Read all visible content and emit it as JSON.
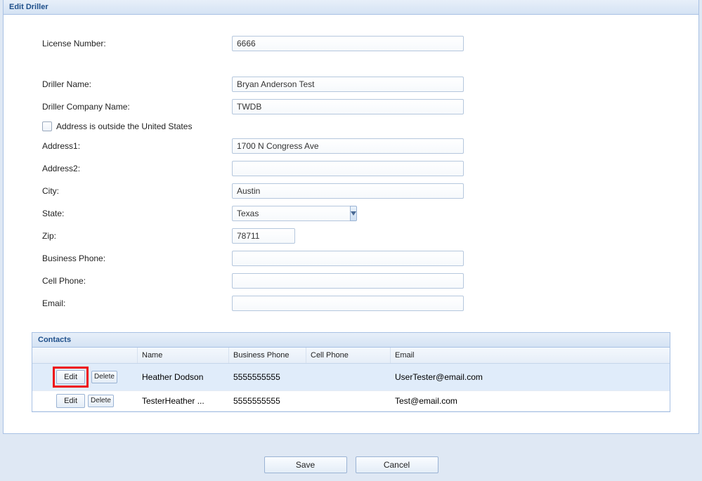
{
  "panel_title": "Edit Driller",
  "form": {
    "license_label": "License Number:",
    "license_value": "6666",
    "driller_name_label": "Driller Name:",
    "driller_name_value": "Bryan Anderson Test",
    "company_label": "Driller Company Name:",
    "company_value": "TWDB",
    "foreign_address_label": "Address is outside the United States",
    "address1_label": "Address1:",
    "address1_value": "1700 N Congress Ave",
    "address2_label": "Address2:",
    "address2_value": "",
    "city_label": "City:",
    "city_value": "Austin",
    "state_label": "State:",
    "state_value": "Texas",
    "zip_label": "Zip:",
    "zip_value": "78711",
    "bphone_label": "Business Phone:",
    "bphone_value": "",
    "cphone_label": "Cell Phone:",
    "cphone_value": "",
    "email_label": "Email:",
    "email_value": ""
  },
  "contacts": {
    "panel_title": "Contacts",
    "headers": {
      "name": "Name",
      "bphone": "Business Phone",
      "cphone": "Cell Phone",
      "email": "Email"
    },
    "rows": [
      {
        "edit": "Edit",
        "delete": "Delete",
        "name": "Heather Dodson",
        "bphone": "5555555555",
        "cphone": "",
        "email": "UserTester@email.com"
      },
      {
        "edit": "Edit",
        "delete": "Delete",
        "name": "TesterHeather ...",
        "bphone": "5555555555",
        "cphone": "",
        "email": "Test@email.com"
      }
    ]
  },
  "buttons": {
    "save": "Save",
    "cancel": "Cancel"
  }
}
